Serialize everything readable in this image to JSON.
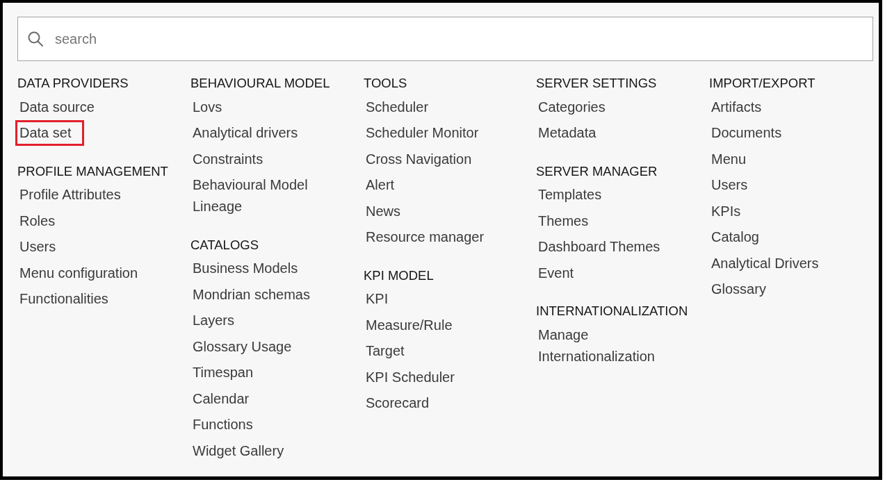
{
  "search": {
    "placeholder": "search"
  },
  "columns": [
    {
      "groups": [
        {
          "title": "DATA PROVIDERS",
          "items": [
            {
              "label": "Data source",
              "highlighted": false
            },
            {
              "label": "Data set",
              "highlighted": true
            }
          ]
        },
        {
          "title": "PROFILE MANAGEMENT",
          "items": [
            {
              "label": "Profile Attributes",
              "highlighted": false
            },
            {
              "label": "Roles",
              "highlighted": false
            },
            {
              "label": "Users",
              "highlighted": false
            },
            {
              "label": "Menu configuration",
              "highlighted": false
            },
            {
              "label": "Functionalities",
              "highlighted": false
            }
          ]
        }
      ]
    },
    {
      "groups": [
        {
          "title": "BEHAVIOURAL MODEL",
          "items": [
            {
              "label": "Lovs",
              "highlighted": false
            },
            {
              "label": "Analytical drivers",
              "highlighted": false
            },
            {
              "label": "Constraints",
              "highlighted": false
            },
            {
              "label": "Behavioural Model Lineage",
              "highlighted": false
            }
          ]
        },
        {
          "title": "CATALOGS",
          "items": [
            {
              "label": "Business Models",
              "highlighted": false
            },
            {
              "label": "Mondrian schemas",
              "highlighted": false
            },
            {
              "label": "Layers",
              "highlighted": false
            },
            {
              "label": "Glossary Usage",
              "highlighted": false
            },
            {
              "label": "Timespan",
              "highlighted": false
            },
            {
              "label": "Calendar",
              "highlighted": false
            },
            {
              "label": "Functions",
              "highlighted": false
            },
            {
              "label": "Widget Gallery",
              "highlighted": false
            }
          ]
        }
      ]
    },
    {
      "groups": [
        {
          "title": "TOOLS",
          "items": [
            {
              "label": "Scheduler",
              "highlighted": false
            },
            {
              "label": "Scheduler Monitor",
              "highlighted": false
            },
            {
              "label": "Cross Navigation",
              "highlighted": false
            },
            {
              "label": "Alert",
              "highlighted": false
            },
            {
              "label": "News",
              "highlighted": false
            },
            {
              "label": "Resource manager",
              "highlighted": false
            }
          ]
        },
        {
          "title": "KPI MODEL",
          "items": [
            {
              "label": "KPI",
              "highlighted": false
            },
            {
              "label": "Measure/Rule",
              "highlighted": false
            },
            {
              "label": "Target",
              "highlighted": false
            },
            {
              "label": "KPI Scheduler",
              "highlighted": false
            },
            {
              "label": "Scorecard",
              "highlighted": false
            }
          ]
        }
      ]
    },
    {
      "groups": [
        {
          "title": "SERVER SETTINGS",
          "items": [
            {
              "label": "Categories",
              "highlighted": false
            },
            {
              "label": "Metadata",
              "highlighted": false
            }
          ]
        },
        {
          "title": "SERVER MANAGER",
          "items": [
            {
              "label": "Templates",
              "highlighted": false
            },
            {
              "label": "Themes",
              "highlighted": false
            },
            {
              "label": "Dashboard Themes",
              "highlighted": false
            },
            {
              "label": "Event",
              "highlighted": false
            }
          ]
        },
        {
          "title": "INTERNATIONALIZATION",
          "items": [
            {
              "label": "Manage Internationalization",
              "highlighted": false
            }
          ]
        }
      ]
    },
    {
      "groups": [
        {
          "title": "IMPORT/EXPORT",
          "items": [
            {
              "label": "Artifacts",
              "highlighted": false
            },
            {
              "label": "Documents",
              "highlighted": false
            },
            {
              "label": "Menu",
              "highlighted": false
            },
            {
              "label": "Users",
              "highlighted": false
            },
            {
              "label": "KPIs",
              "highlighted": false
            },
            {
              "label": "Catalog",
              "highlighted": false
            },
            {
              "label": "Analytical Drivers",
              "highlighted": false
            },
            {
              "label": "Glossary",
              "highlighted": false
            }
          ]
        }
      ]
    }
  ]
}
